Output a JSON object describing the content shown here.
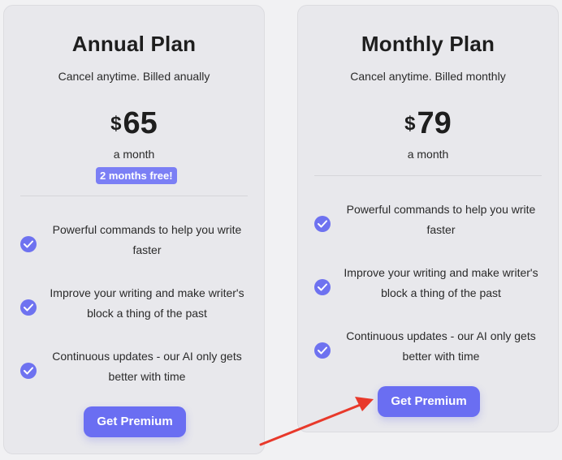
{
  "plans": [
    {
      "title": "Annual Plan",
      "subtitle": "Cancel anytime. Billed anually",
      "currency": "$",
      "amount": "65",
      "period": "a month",
      "badge": "2 months free!",
      "features": [
        {
          "line1": "Powerful commands to help you write",
          "line2": "faster"
        },
        {
          "line1": "Improve your writing and make writer's",
          "line2": "block a thing of the past"
        },
        {
          "line1": "Continuous updates - our AI only gets",
          "line2": "better with time"
        }
      ],
      "cta": "Get Premium"
    },
    {
      "title": "Monthly Plan",
      "subtitle": "Cancel anytime. Billed monthly",
      "currency": "$",
      "amount": "79",
      "period": "a month",
      "features": [
        {
          "line1": "Powerful commands to help you write",
          "line2": "faster"
        },
        {
          "line1": "Improve your writing and make writer's",
          "line2": "block a thing of the past"
        },
        {
          "line1": "Continuous updates - our AI only gets",
          "line2": "better with time"
        }
      ],
      "cta": "Get Premium"
    }
  ],
  "colors": {
    "accent": "#6a6ef2",
    "check": "#6e72f0",
    "badge": "#7b7ff5",
    "annotation_arrow": "#e8392b"
  },
  "icons": {
    "feature_check": "check-circle-icon",
    "annotation": "red-arrow-annotation"
  }
}
